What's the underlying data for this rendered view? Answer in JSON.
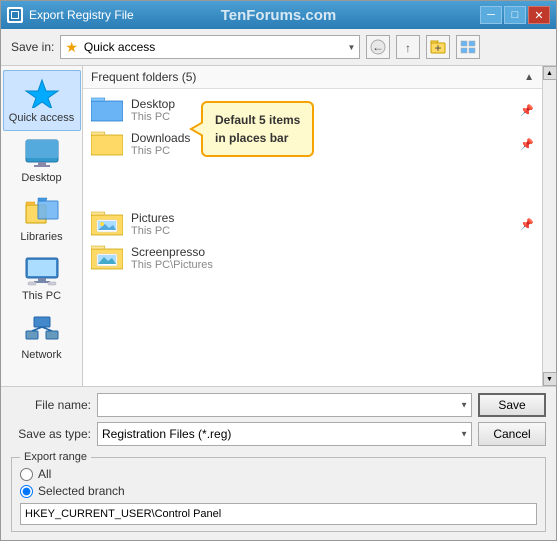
{
  "window": {
    "title": "Export Registry File",
    "watermark": "TenForums.com"
  },
  "toolbar": {
    "save_in_label": "Save in:",
    "location": "Quick access",
    "location_star": "★"
  },
  "places_bar": {
    "items": [
      {
        "id": "quick-access",
        "label": "Quick access",
        "icon": "★",
        "active": true
      },
      {
        "id": "desktop",
        "label": "Desktop",
        "icon": "🖥"
      },
      {
        "id": "libraries",
        "label": "Libraries",
        "icon": "📚"
      },
      {
        "id": "this-pc",
        "label": "This PC",
        "icon": "💻"
      },
      {
        "id": "network",
        "label": "Network",
        "icon": "🖧"
      }
    ]
  },
  "file_panel": {
    "section_label": "Frequent folders (5)",
    "items": [
      {
        "name": "Desktop",
        "sub": "This PC",
        "has_pin": true,
        "icon_type": "blue-folder"
      },
      {
        "name": "Downloads",
        "sub": "This PC",
        "has_pin": true,
        "icon_type": "yellow-folder"
      },
      {
        "name": "Pictures",
        "sub": "This PC",
        "has_pin": true,
        "icon_type": "picture-folder"
      },
      {
        "name": "Screenpresso",
        "sub": "This PC\\Pictures",
        "has_pin": false,
        "icon_type": "screenpresso-folder"
      }
    ],
    "callout_text": "Default 5 items\nin places bar"
  },
  "bottom_bar": {
    "file_name_label": "File name:",
    "file_name_value": "",
    "file_name_placeholder": "",
    "save_as_type_label": "Save as type:",
    "save_as_type_value": "Registration Files (*.reg)",
    "save_btn": "Save",
    "cancel_btn": "Cancel"
  },
  "export_range": {
    "legend": "Export range",
    "all_label": "All",
    "selected_branch_label": "Selected branch",
    "branch_value": "HKEY_CURRENT_USER\\Control Panel"
  }
}
